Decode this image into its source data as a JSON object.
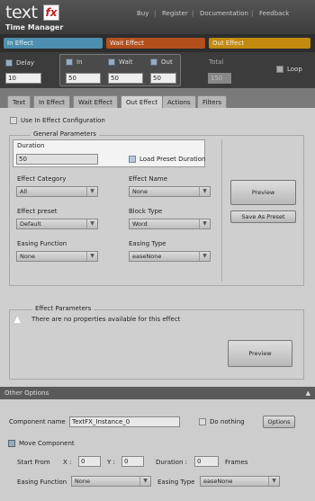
{
  "header": {
    "logo": "text",
    "logo_badge": "fx",
    "title": "Time Manager",
    "nav": [
      "Buy",
      "Register",
      "Documentation",
      "Feedback"
    ]
  },
  "timeline": {
    "segments": [
      {
        "label": "In Effect",
        "color": "#4d8fae"
      },
      {
        "label": "Wait Effect",
        "color": "#b24f1d"
      },
      {
        "label": "Out Effect",
        "color": "#c38a10"
      }
    ]
  },
  "durations": {
    "delay": {
      "label": "Delay",
      "value": "10"
    },
    "in": {
      "label": "In",
      "value": "50"
    },
    "wait": {
      "label": "Wait",
      "value": "50"
    },
    "out": {
      "label": "Out",
      "value": "50"
    },
    "total": {
      "label": "Total",
      "value": "150"
    },
    "loop": {
      "label": "Loop"
    }
  },
  "tabs": [
    "Text",
    "In Effect",
    "Wait Effect",
    "Out Effect",
    "Actions",
    "Filters"
  ],
  "active_tab": "Out Effect",
  "out_effect": {
    "use_in_config": "Use In Effect Configuration",
    "general_params": "General Parameters",
    "duration_label": "Duration",
    "duration_value": "50",
    "load_preset_duration": "Load Preset Duration",
    "effect_category_label": "Effect Category",
    "effect_category_value": "All",
    "effect_name_label": "Effect Name",
    "effect_name_value": "None",
    "effect_preset_label": "Effect preset",
    "effect_preset_value": "Default",
    "block_type_label": "Block Type",
    "block_type_value": "Word",
    "easing_function_label": "Easing Function",
    "easing_function_value": "None",
    "easing_type_label": "Easing Type",
    "easing_type_value": "easeNone",
    "preview_btn": "Preview",
    "save_preset_btn": "Save As Preset",
    "effect_params": "Effect Parameters",
    "no_props": "There are no properties available for this effect",
    "preview_btn2": "Preview"
  },
  "other_options": {
    "title": "Other Options",
    "component_name_label": "Component name",
    "component_name_value": "TextFX_Instance_0",
    "do_nothing": "Do nothing",
    "options_btn": "Options",
    "move_component": "Move Component",
    "start_from": "Start From",
    "x_label": "X :",
    "x_value": "0",
    "y_label": "Y :",
    "y_value": "0",
    "duration_label": "Duration :",
    "duration_value": "0",
    "frames": "Frames",
    "easing_function_label": "Easing Function",
    "easing_function_value": "None",
    "easing_type_label": "Easing Type",
    "easing_type_value": "easeNone"
  }
}
